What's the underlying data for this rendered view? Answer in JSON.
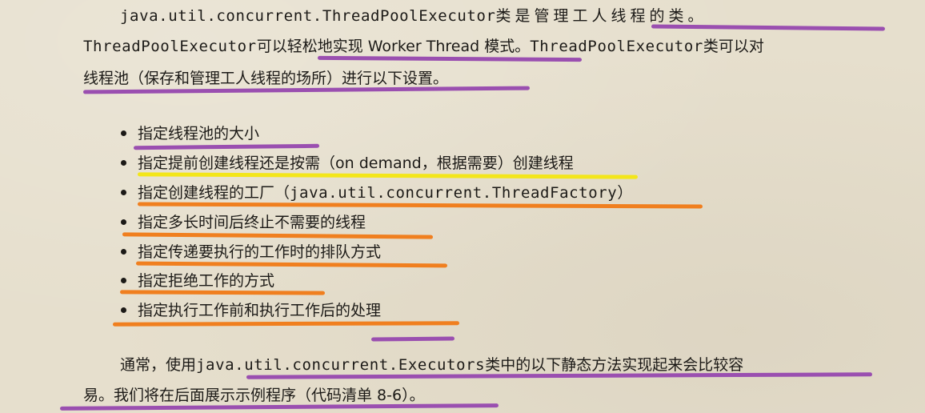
{
  "paragraph1": {
    "line1": {
      "code": "java.util.concurrent.ThreadPoolExecutor",
      "text": "类是管理工人线程的类。"
    },
    "line2": {
      "code": "ThreadPoolExecutor",
      "text": "可以轻松地实现 Worker Thread 模式。",
      "code2": "ThreadPoolExecutor",
      "text2": "类可以对"
    },
    "line3": {
      "text": "线程池（保存和管理工人线程的场所）进行以下设置。"
    }
  },
  "bullets": [
    {
      "text": "指定线程池的大小"
    },
    {
      "text": "指定提前创建线程还是按需（on demand，根据需要）创建线程"
    },
    {
      "text_before": "指定创建线程的工厂（",
      "code": "java.util.concurrent.ThreadFactory",
      "text_after": "）"
    },
    {
      "text": "指定多长时间后终止不需要的线程"
    },
    {
      "text": "指定传递要执行的工作时的排队方式"
    },
    {
      "text": "指定拒绝工作的方式"
    },
    {
      "text": "指定执行工作前和执行工作后的处理"
    }
  ],
  "paragraph2": {
    "line1": {
      "text": "通常，使用",
      "code": "java.util.concurrent.Executors",
      "text2": "类中的以下静态方法实现起来会比较容"
    },
    "line2": {
      "text": "易。我们将在后面展示示例程序（代码清单 8-6）。"
    }
  },
  "colors": {
    "background": "#e6dfcd",
    "highlight_purple": "#9a4fb0",
    "highlight_orange": "#f07f1f",
    "highlight_yellow": "#f3e61a"
  }
}
